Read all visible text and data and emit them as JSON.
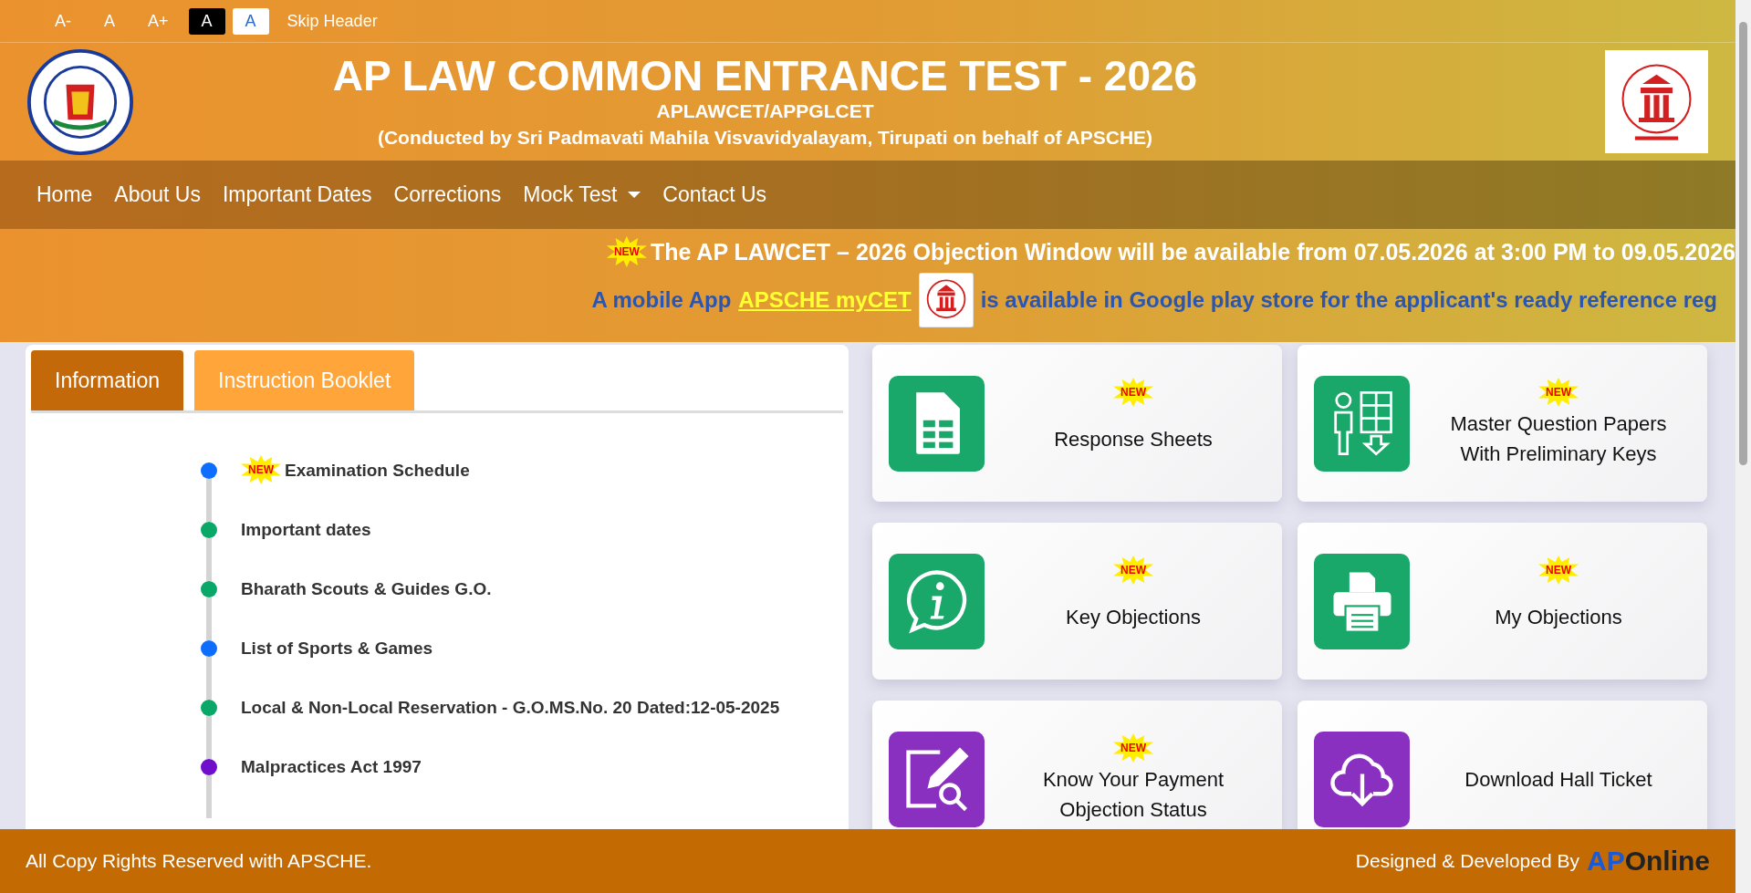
{
  "font_controls": [
    {
      "label": "A-",
      "kind": "plain"
    },
    {
      "label": "A",
      "kind": "plain"
    },
    {
      "label": "A+",
      "kind": "plain"
    },
    {
      "label": "A",
      "kind": "dark"
    },
    {
      "label": "A",
      "kind": "light"
    }
  ],
  "skip_header": "Skip Header",
  "header": {
    "title": "AP LAW COMMON ENTRANCE TEST - 2026",
    "subtitle": "APLAWCET/APPGLCET",
    "conducted": "(Conducted by Sri Padmavati Mahila Visvavidyalayam, Tirupati on behalf of APSCHE)"
  },
  "nav": [
    {
      "label": "Home",
      "has_menu": false
    },
    {
      "label": "About Us",
      "has_menu": false
    },
    {
      "label": "Important Dates",
      "has_menu": false
    },
    {
      "label": "Corrections",
      "has_menu": false
    },
    {
      "label": "Mock Test",
      "has_menu": true
    },
    {
      "label": "Contact Us",
      "has_menu": false
    }
  ],
  "announcement": {
    "badge": "NEW",
    "text": "The AP LAWCET – 2026 Objection Window will be available from 07.05.2026 at 3:00 PM to 09.05.2026"
  },
  "app_notice": {
    "before": "A mobile App",
    "link": "APSCHE myCET",
    "after": "is available in Google play store for the applicant's ready reference reg"
  },
  "tabs": [
    {
      "label": "Information",
      "selected": true
    },
    {
      "label": "Instruction Booklet",
      "selected": false
    }
  ],
  "timeline": [
    {
      "label": "Examination Schedule",
      "color": "#0d6efd",
      "badge": "NEW"
    },
    {
      "label": "Important dates",
      "color": "#0aa868"
    },
    {
      "label": "Bharath Scouts & Guides G.O.",
      "color": "#0aa868"
    },
    {
      "label": "List of Sports & Games",
      "color": "#0d6efd"
    },
    {
      "label": "Local & Non-Local Reservation - G.O.MS.No. 20 Dated:12-05-2025",
      "color": "#0aa868"
    },
    {
      "label": "Malpractices Act 1997",
      "color": "#6f0fcc"
    }
  ],
  "cards": [
    {
      "label": "Response Sheets",
      "badge": "NEW",
      "kind": "sheet",
      "color": "#1aa86a"
    },
    {
      "label": "Master Question Papers With Preliminary Keys",
      "badge": "NEW",
      "kind": "person-grid",
      "color": "#1aa86a"
    },
    {
      "label": "Key Objections",
      "badge": "NEW",
      "kind": "info",
      "color": "#1aa86a"
    },
    {
      "label": "My Objections",
      "badge": "NEW",
      "kind": "printer",
      "color": "#1aa86a"
    },
    {
      "label": "Know Your Payment Objection Status",
      "badge": "NEW",
      "kind": "edit-search",
      "color": "#8a30c0"
    },
    {
      "label": "Download Hall Ticket",
      "kind": "cloud-download",
      "color": "#8a30c0"
    }
  ],
  "footer": {
    "copyright": "All Copy Rights Reserved with APSCHE.",
    "designed_by": "Designed & Developed By",
    "logo_primary": "AP",
    "logo_secondary": "Online"
  }
}
